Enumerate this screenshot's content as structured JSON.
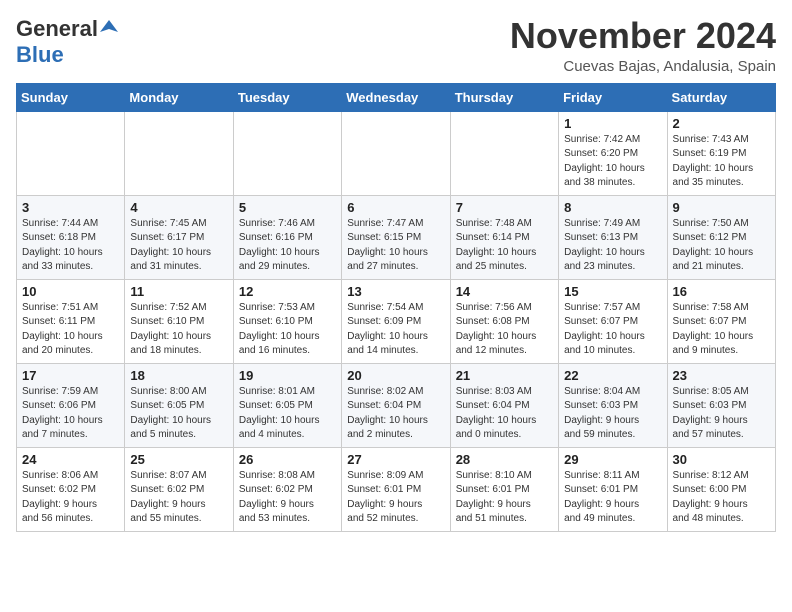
{
  "logo": {
    "line1": "General",
    "line2": "Blue"
  },
  "header": {
    "month": "November 2024",
    "location": "Cuevas Bajas, Andalusia, Spain"
  },
  "weekdays": [
    "Sunday",
    "Monday",
    "Tuesday",
    "Wednesday",
    "Thursday",
    "Friday",
    "Saturday"
  ],
  "weeks": [
    [
      {
        "day": "",
        "info": ""
      },
      {
        "day": "",
        "info": ""
      },
      {
        "day": "",
        "info": ""
      },
      {
        "day": "",
        "info": ""
      },
      {
        "day": "",
        "info": ""
      },
      {
        "day": "1",
        "info": "Sunrise: 7:42 AM\nSunset: 6:20 PM\nDaylight: 10 hours\nand 38 minutes."
      },
      {
        "day": "2",
        "info": "Sunrise: 7:43 AM\nSunset: 6:19 PM\nDaylight: 10 hours\nand 35 minutes."
      }
    ],
    [
      {
        "day": "3",
        "info": "Sunrise: 7:44 AM\nSunset: 6:18 PM\nDaylight: 10 hours\nand 33 minutes."
      },
      {
        "day": "4",
        "info": "Sunrise: 7:45 AM\nSunset: 6:17 PM\nDaylight: 10 hours\nand 31 minutes."
      },
      {
        "day": "5",
        "info": "Sunrise: 7:46 AM\nSunset: 6:16 PM\nDaylight: 10 hours\nand 29 minutes."
      },
      {
        "day": "6",
        "info": "Sunrise: 7:47 AM\nSunset: 6:15 PM\nDaylight: 10 hours\nand 27 minutes."
      },
      {
        "day": "7",
        "info": "Sunrise: 7:48 AM\nSunset: 6:14 PM\nDaylight: 10 hours\nand 25 minutes."
      },
      {
        "day": "8",
        "info": "Sunrise: 7:49 AM\nSunset: 6:13 PM\nDaylight: 10 hours\nand 23 minutes."
      },
      {
        "day": "9",
        "info": "Sunrise: 7:50 AM\nSunset: 6:12 PM\nDaylight: 10 hours\nand 21 minutes."
      }
    ],
    [
      {
        "day": "10",
        "info": "Sunrise: 7:51 AM\nSunset: 6:11 PM\nDaylight: 10 hours\nand 20 minutes."
      },
      {
        "day": "11",
        "info": "Sunrise: 7:52 AM\nSunset: 6:10 PM\nDaylight: 10 hours\nand 18 minutes."
      },
      {
        "day": "12",
        "info": "Sunrise: 7:53 AM\nSunset: 6:10 PM\nDaylight: 10 hours\nand 16 minutes."
      },
      {
        "day": "13",
        "info": "Sunrise: 7:54 AM\nSunset: 6:09 PM\nDaylight: 10 hours\nand 14 minutes."
      },
      {
        "day": "14",
        "info": "Sunrise: 7:56 AM\nSunset: 6:08 PM\nDaylight: 10 hours\nand 12 minutes."
      },
      {
        "day": "15",
        "info": "Sunrise: 7:57 AM\nSunset: 6:07 PM\nDaylight: 10 hours\nand 10 minutes."
      },
      {
        "day": "16",
        "info": "Sunrise: 7:58 AM\nSunset: 6:07 PM\nDaylight: 10 hours\nand 9 minutes."
      }
    ],
    [
      {
        "day": "17",
        "info": "Sunrise: 7:59 AM\nSunset: 6:06 PM\nDaylight: 10 hours\nand 7 minutes."
      },
      {
        "day": "18",
        "info": "Sunrise: 8:00 AM\nSunset: 6:05 PM\nDaylight: 10 hours\nand 5 minutes."
      },
      {
        "day": "19",
        "info": "Sunrise: 8:01 AM\nSunset: 6:05 PM\nDaylight: 10 hours\nand 4 minutes."
      },
      {
        "day": "20",
        "info": "Sunrise: 8:02 AM\nSunset: 6:04 PM\nDaylight: 10 hours\nand 2 minutes."
      },
      {
        "day": "21",
        "info": "Sunrise: 8:03 AM\nSunset: 6:04 PM\nDaylight: 10 hours\nand 0 minutes."
      },
      {
        "day": "22",
        "info": "Sunrise: 8:04 AM\nSunset: 6:03 PM\nDaylight: 9 hours\nand 59 minutes."
      },
      {
        "day": "23",
        "info": "Sunrise: 8:05 AM\nSunset: 6:03 PM\nDaylight: 9 hours\nand 57 minutes."
      }
    ],
    [
      {
        "day": "24",
        "info": "Sunrise: 8:06 AM\nSunset: 6:02 PM\nDaylight: 9 hours\nand 56 minutes."
      },
      {
        "day": "25",
        "info": "Sunrise: 8:07 AM\nSunset: 6:02 PM\nDaylight: 9 hours\nand 55 minutes."
      },
      {
        "day": "26",
        "info": "Sunrise: 8:08 AM\nSunset: 6:02 PM\nDaylight: 9 hours\nand 53 minutes."
      },
      {
        "day": "27",
        "info": "Sunrise: 8:09 AM\nSunset: 6:01 PM\nDaylight: 9 hours\nand 52 minutes."
      },
      {
        "day": "28",
        "info": "Sunrise: 8:10 AM\nSunset: 6:01 PM\nDaylight: 9 hours\nand 51 minutes."
      },
      {
        "day": "29",
        "info": "Sunrise: 8:11 AM\nSunset: 6:01 PM\nDaylight: 9 hours\nand 49 minutes."
      },
      {
        "day": "30",
        "info": "Sunrise: 8:12 AM\nSunset: 6:00 PM\nDaylight: 9 hours\nand 48 minutes."
      }
    ]
  ]
}
